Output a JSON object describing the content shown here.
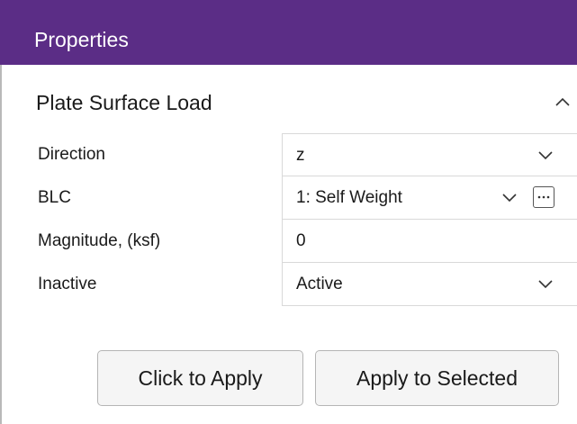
{
  "header": {
    "title": "Properties",
    "background": "#5b2d86"
  },
  "section": {
    "title": "Plate Surface Load",
    "collapse_icon": "chevron-up-icon"
  },
  "fields": {
    "direction": {
      "label": "Direction",
      "value": "z",
      "icon": "chevron-down-icon"
    },
    "blc": {
      "label": "BLC",
      "value": "1: Self Weight",
      "icon": "chevron-down-icon",
      "browse_icon": "ellipsis-icon"
    },
    "magnitude": {
      "label": "Magnitude, (ksf)",
      "value": "0"
    },
    "inactive": {
      "label": "Inactive",
      "value": "Active",
      "icon": "chevron-down-icon"
    }
  },
  "buttons": {
    "click_to_apply": "Click to Apply",
    "apply_to_selected": "Apply to Selected"
  }
}
